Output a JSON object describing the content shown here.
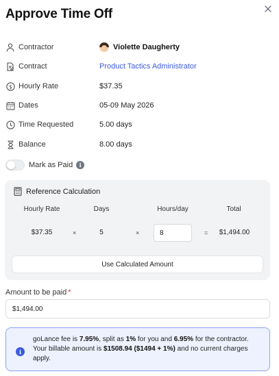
{
  "dialog": {
    "title": "Approve Time Off"
  },
  "details": {
    "contractor": {
      "label": "Contractor",
      "value": "Violette Daugherty",
      "icon": "person-icon"
    },
    "contract": {
      "label": "Contract",
      "value": "Product Tactics Administrator",
      "icon": "contract-icon"
    },
    "hourly_rate": {
      "label": "Hourly Rate",
      "value": "$37.35",
      "icon": "dollar-circle-icon"
    },
    "dates": {
      "label": "Dates",
      "value": "05-09 May 2026",
      "icon": "calendar-icon"
    },
    "time_requested": {
      "label": "Time Requested",
      "value": "5.00 days",
      "icon": "clock-icon"
    },
    "balance": {
      "label": "Balance",
      "value": "8.00 days",
      "icon": "hourglass-icon"
    }
  },
  "mark_as_paid": {
    "label": "Mark as Paid",
    "checked": false
  },
  "reference": {
    "title": "Reference Calculation",
    "headers": {
      "hourly_rate": "Hourly Rate",
      "days": "Days",
      "hours_per_day": "Hours/day",
      "total": "Total"
    },
    "values": {
      "hourly_rate": "$37.35",
      "days": "5",
      "hours_per_day": "8",
      "total": "$1,494.00"
    },
    "operators": {
      "times": "×",
      "equals": "="
    },
    "use_button": "Use Calculated Amount"
  },
  "amount": {
    "label": "Amount to be paid",
    "required_mark": "*",
    "value": "$1,494.00"
  },
  "fee_notice": {
    "t1": "goLance fee is ",
    "fee_pct": "7.95%",
    "t2": ", split as ",
    "your_pct": "1%",
    "t3": " for you and ",
    "contractor_pct": "6.95%",
    "t4": " for the contractor. Your billable amount is ",
    "billable": "$1508.94 ($1494 + 1%)",
    "t5": " and no current charges apply."
  },
  "colors": {
    "accent": "#3b5bdb",
    "info_bg": "#eef2ff",
    "info_border": "#8ea0f2",
    "required": "#e03131",
    "card_bg": "#f2f3f5"
  }
}
